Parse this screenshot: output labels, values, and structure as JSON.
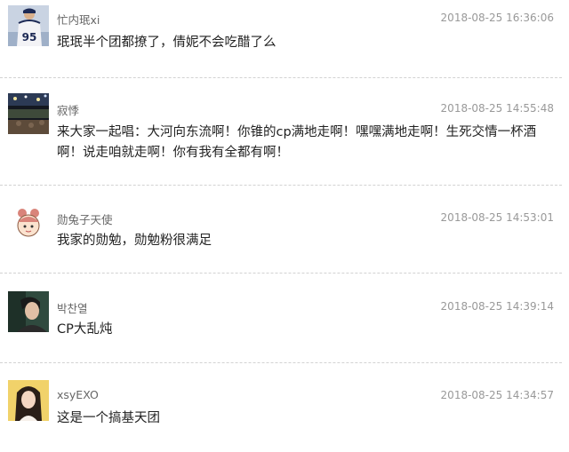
{
  "comments": [
    {
      "username": "忙内珉xi",
      "timestamp": "2018-08-25 16:36:06",
      "text": "珉珉半个团都撩了，倩妮不会吃醋了么",
      "avatar": "user-avatar-baseball"
    },
    {
      "username": "寂悸",
      "timestamp": "2018-08-25 14:55:48",
      "text": "来大家一起唱：大河向东流啊！你锥的cp满地走啊！嘿嘿满地走啊！生死交情一杯酒啊！说走咱就走啊！你有我有全都有啊！",
      "avatar": "user-avatar-concert"
    },
    {
      "username": "勋兔子天使",
      "timestamp": "2018-08-25 14:53:01",
      "text": "我家的勋勉，勋勉粉很满足",
      "avatar": "user-avatar-cartoon"
    },
    {
      "username": "박찬열",
      "timestamp": "2018-08-25 14:39:14",
      "text": "CP大乱炖",
      "avatar": "user-avatar-portrait"
    },
    {
      "username": "xsyEXO",
      "timestamp": "2018-08-25 14:34:57",
      "text": "这是一个搞基天团",
      "avatar": "user-avatar-girl"
    }
  ],
  "colors": {
    "username": "#666666",
    "timestamp": "#999999",
    "text": "#222222",
    "divider": "#d2d2d2"
  }
}
